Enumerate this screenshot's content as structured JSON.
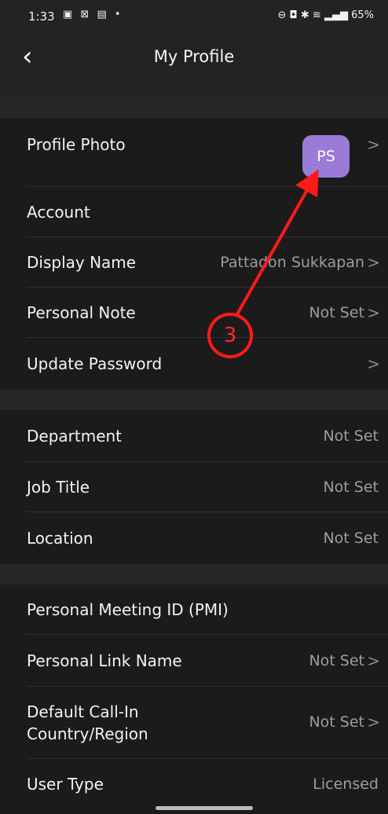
{
  "status_bar": {
    "time": "1:33",
    "left_icons": "▣ ⊠ ▤ •",
    "right_icons": "⊖ ◘ ✱ ≋ ▂▄▆",
    "battery": "65%"
  },
  "header": {
    "title": "My Profile",
    "back_icon": "‹"
  },
  "sections": [
    {
      "items": [
        {
          "label": "Profile Photo",
          "avatar_initials": "PS",
          "avatar_color": "#9a7bd7",
          "chevron": true
        },
        {
          "label": "Account",
          "value": "",
          "chevron": false
        },
        {
          "label": "Display Name",
          "value": "Pattadon Sukkapan",
          "chevron": true
        },
        {
          "label": "Personal Note",
          "value": "Not Set",
          "chevron": true
        },
        {
          "label": "Update Password",
          "value": "",
          "chevron": true
        }
      ]
    },
    {
      "items": [
        {
          "label": "Department",
          "value": "Not Set",
          "chevron": false
        },
        {
          "label": "Job Title",
          "value": "Not Set",
          "chevron": false
        },
        {
          "label": "Location",
          "value": "Not Set",
          "chevron": false
        }
      ]
    },
    {
      "items": [
        {
          "label": "Personal Meeting ID (PMI)",
          "value": "",
          "chevron": false
        },
        {
          "label": "Personal Link Name",
          "value": "Not Set",
          "chevron": true
        },
        {
          "label_line1": "Default Call-In",
          "label_line2": "Country/Region",
          "value": "Not Set",
          "chevron": true
        },
        {
          "label": "User Type",
          "value": "Licensed",
          "chevron": false
        }
      ]
    }
  ],
  "annotation": {
    "number": "3",
    "color": "#ff1a1a"
  },
  "chevron_glyph": ">"
}
